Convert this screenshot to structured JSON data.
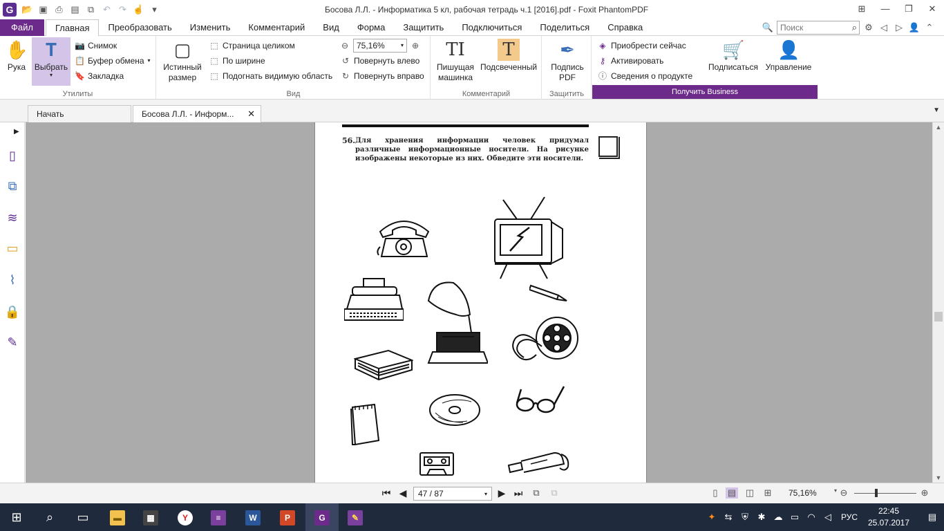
{
  "window": {
    "title": "Босова Л.Л. - Информатика 5 кл, рабочая тетрадь ч.1 [2016].pdf - Foxit PhantomPDF",
    "app_icon": "G"
  },
  "menubar": {
    "file": "Файл",
    "tabs": [
      "Главная",
      "Преобразовать",
      "Изменить",
      "Комментарий",
      "Вид",
      "Форма",
      "Защитить",
      "Подключиться",
      "Поделиться",
      "Справка"
    ],
    "active_tab": "Главная",
    "search_placeholder": "Поиск"
  },
  "ribbon": {
    "tools": {
      "label": "Утилиты",
      "hand": "Рука",
      "select": "Выбрать",
      "snapshot": "Снимок",
      "clipboard": "Буфер обмена",
      "bookmark": "Закладка"
    },
    "view": {
      "label": "Вид",
      "actual_size_1": "Истинный",
      "actual_size_2": "размер",
      "fit_page": "Страница целиком",
      "fit_width": "По ширине",
      "fit_visible": "Подогнать видимую область",
      "zoom_value": "75,16%",
      "rotate_left": "Повернуть влево",
      "rotate_right": "Повернуть вправо"
    },
    "comment": {
      "label": "Комментарий",
      "typewriter_1": "Пишущая",
      "typewriter_2": "машинка",
      "highlight": "Подсвеченный"
    },
    "protect": {
      "label": "Защитить",
      "sign_1": "Подпись",
      "sign_2": "PDF"
    },
    "business": {
      "label": "Получить Business",
      "buy": "Приобрести сейчас",
      "activate": "Активировать",
      "about": "Сведения о продукте",
      "subscribe": "Подписаться",
      "manage": "Управление"
    }
  },
  "doc_tabs": {
    "start": "Начать",
    "document": "Босова Л.Л. - Информ..."
  },
  "page": {
    "task_number": "56.",
    "task_text": "Для хранения информации человек придумал различные информационные носители. На рисунке изображены некоторые из них. Обведите эти носители."
  },
  "statusbar": {
    "page_display": "47 / 87",
    "zoom": "75,16%"
  },
  "taskbar": {
    "lang": "РУС",
    "time": "22:45",
    "date": "25.07.2017"
  },
  "colors": {
    "accent": "#6c2b8a",
    "selected_bg": "#d4c5e8",
    "doc_background": "#ababab",
    "taskbar": "#1f2a3c"
  },
  "icons": {
    "nav": [
      "page-thumbnails-icon",
      "layers-pages-icon",
      "layers-icon",
      "comments-icon",
      "attachments-icon",
      "security-lock-icon",
      "signature-validate-icon"
    ]
  }
}
